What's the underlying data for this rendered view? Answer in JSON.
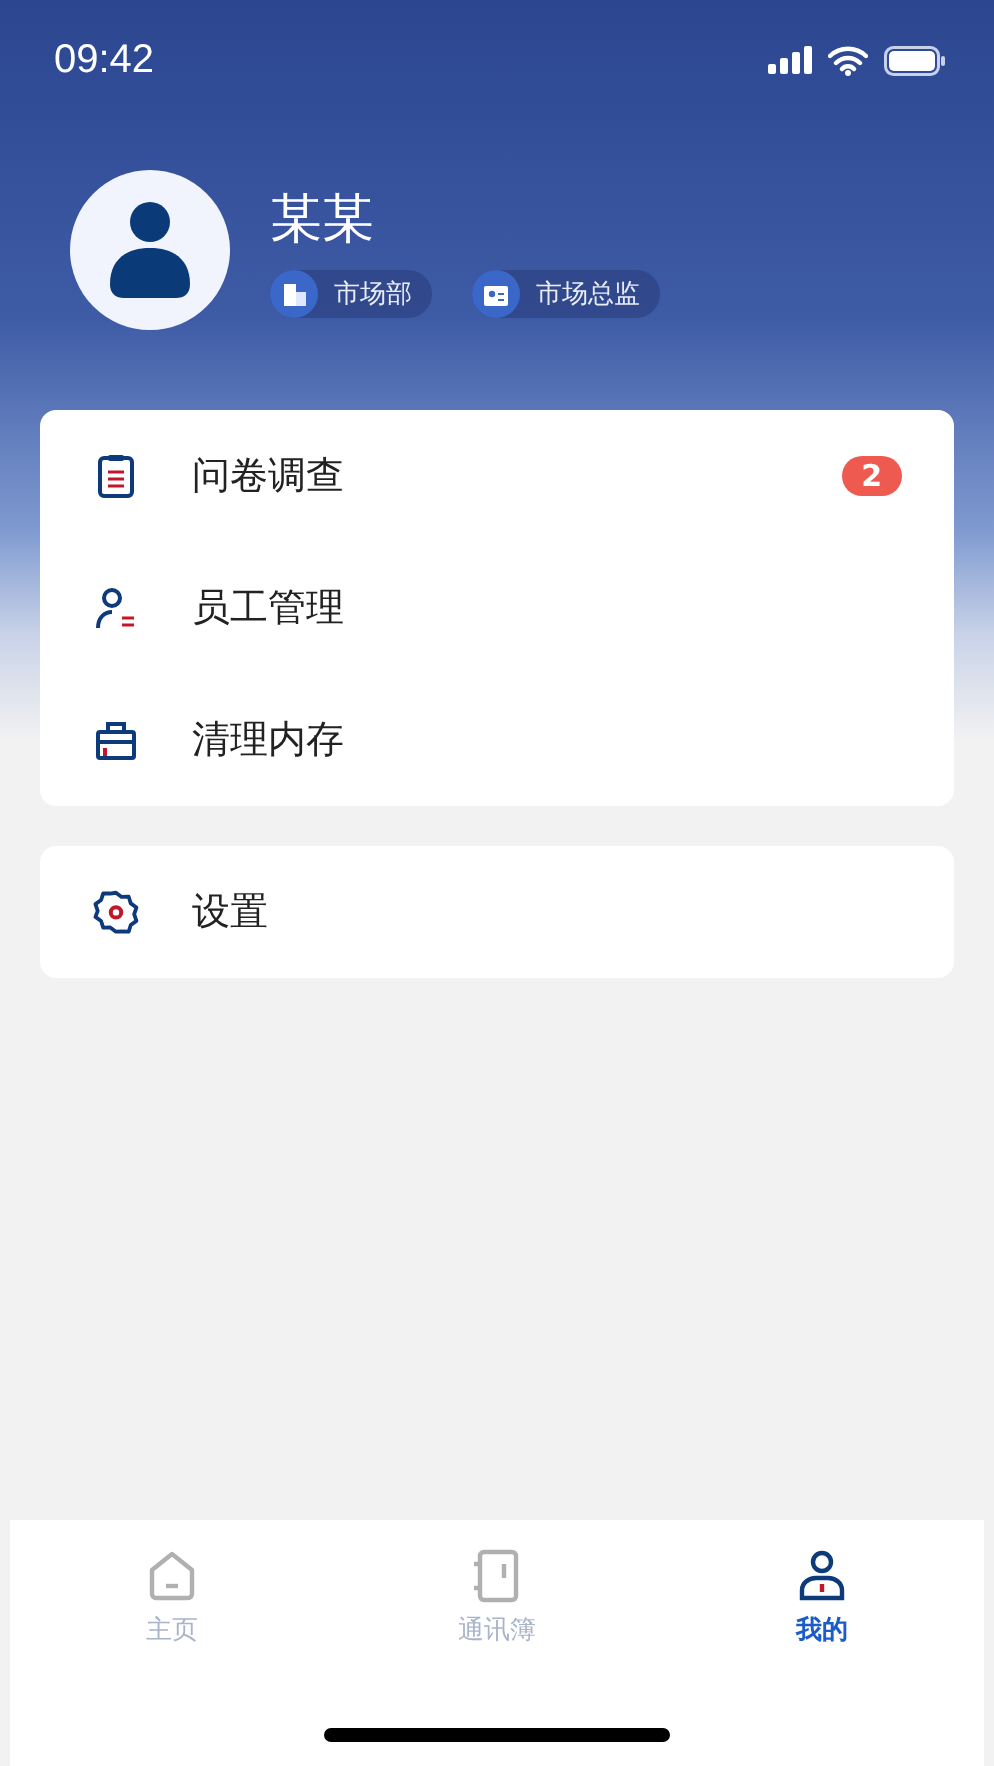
{
  "status_bar": {
    "time": "09:42"
  },
  "profile": {
    "name": "某某",
    "tags": [
      {
        "kind": "department",
        "label": "市场部"
      },
      {
        "kind": "position",
        "label": "市场总监"
      }
    ]
  },
  "menu_groups": [
    {
      "items": [
        {
          "kind": "survey",
          "label": "问卷调查",
          "badge": "2"
        },
        {
          "kind": "staff",
          "label": "员工管理"
        },
        {
          "kind": "clean",
          "label": "清理内存"
        }
      ]
    },
    {
      "items": [
        {
          "kind": "settings",
          "label": "设置"
        }
      ]
    }
  ],
  "tab_bar": [
    {
      "kind": "home",
      "label": "主页",
      "selected": false
    },
    {
      "kind": "contacts",
      "label": "通讯簿",
      "selected": false
    },
    {
      "kind": "me",
      "label": "我的",
      "selected": true
    }
  ]
}
